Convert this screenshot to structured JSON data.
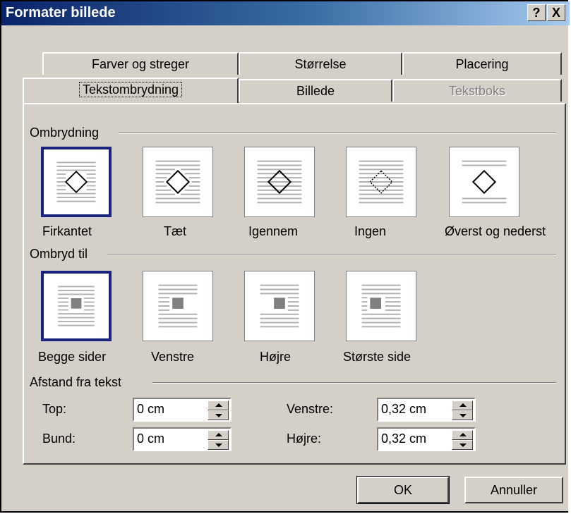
{
  "window": {
    "title": "Formater billede"
  },
  "title_buttons": {
    "help": "?",
    "close": "X"
  },
  "tabs_back": [
    {
      "label": "Farver og streger"
    },
    {
      "label": "Størrelse"
    },
    {
      "label": "Placering"
    }
  ],
  "tabs_front": [
    {
      "label": "Tekstombrydning",
      "active": true
    },
    {
      "label": "Billede"
    },
    {
      "label": "Tekstboks",
      "disabled": true
    }
  ],
  "wrapping": {
    "heading": "Ombrydning",
    "options": [
      {
        "label": "Firkantet",
        "selected": true
      },
      {
        "label": "Tæt"
      },
      {
        "label": "Igennem"
      },
      {
        "label": "Ingen"
      },
      {
        "label": "Øverst og nederst"
      }
    ]
  },
  "wrap_to": {
    "heading": "Ombryd til",
    "options": [
      {
        "label": "Begge sider",
        "selected": true
      },
      {
        "label": "Venstre"
      },
      {
        "label": "Højre"
      },
      {
        "label": "Største side"
      }
    ]
  },
  "distance": {
    "heading": "Afstand fra tekst",
    "top": {
      "label": "Top:",
      "value": "0 cm"
    },
    "bottom": {
      "label": "Bund:",
      "value": "0 cm"
    },
    "left": {
      "label": "Venstre:",
      "value": "0,32 cm"
    },
    "right": {
      "label": "Højre:",
      "value": "0,32 cm"
    }
  },
  "buttons": {
    "ok": "OK",
    "cancel": "Annuller"
  }
}
